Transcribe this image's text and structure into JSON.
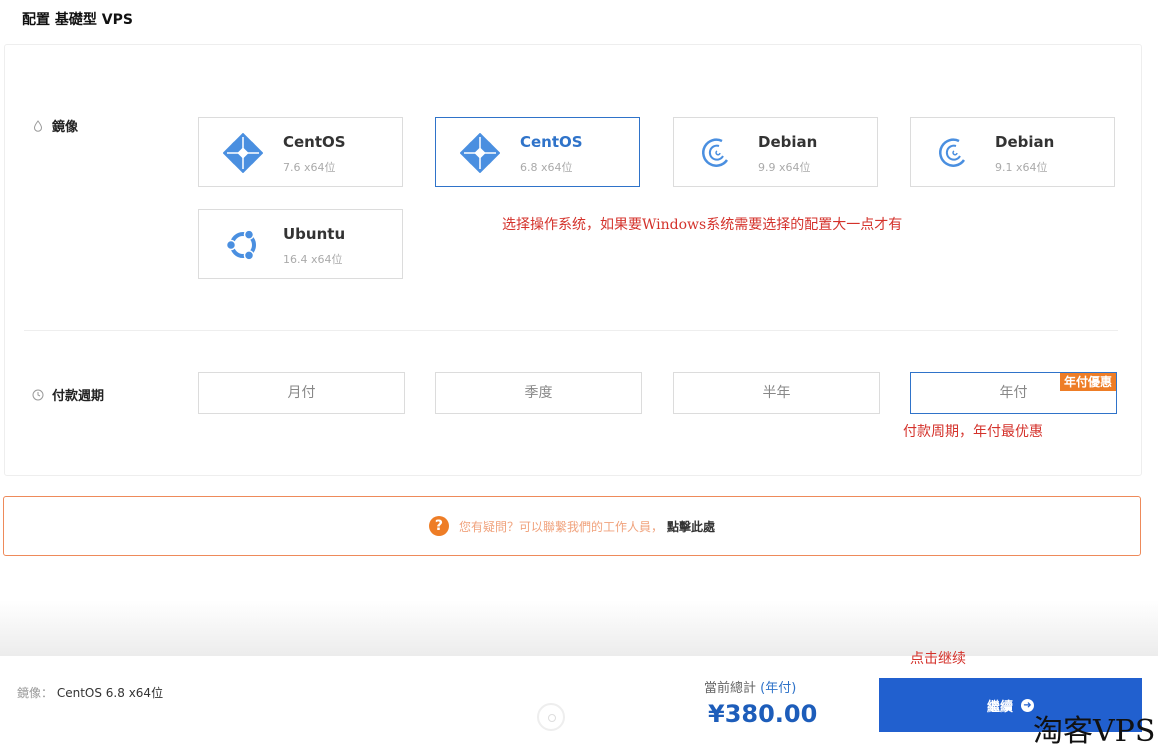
{
  "page": {
    "title": "配置 基礎型 VPS"
  },
  "image_section": {
    "label": "鏡像",
    "os_options": [
      {
        "name": "CentOS",
        "version": "7.6 x64位",
        "icon": "centos-icon",
        "selected": false
      },
      {
        "name": "CentOS",
        "version": "6.8 x64位",
        "icon": "centos-icon",
        "selected": true
      },
      {
        "name": "Debian",
        "version": "9.9 x64位",
        "icon": "debian-icon",
        "selected": false
      },
      {
        "name": "Debian",
        "version": "9.1 x64位",
        "icon": "debian-icon",
        "selected": false
      },
      {
        "name": "Ubuntu",
        "version": "16.4 x64位",
        "icon": "ubuntu-icon",
        "selected": false
      }
    ],
    "annotation": "选择操作系统，如果要Windows系统需要选择的配置大一点才有"
  },
  "period_section": {
    "label": "付款週期",
    "options": [
      "月付",
      "季度",
      "半年",
      "年付"
    ],
    "selected": "年付",
    "promo_badge": "年付優惠",
    "annotation": "付款周期，年付最优惠"
  },
  "help": {
    "text": "您有疑問？可以聯繫我們的工作人員，",
    "link": "點擊此處"
  },
  "footer": {
    "summary_key": "鏡像：",
    "summary_value": "CentOS 6.8 x64位",
    "total_label": "當前總計",
    "total_period": "(年付)",
    "total_price": "¥380.00",
    "continue_label": "繼續",
    "continue_annotation": "点击继续"
  },
  "watermark": "淘客VPS",
  "colors": {
    "accent": "#2160cf",
    "selected_border": "#2f73c9",
    "orange": "#ee7d26",
    "annotation_red": "#d4322b"
  }
}
